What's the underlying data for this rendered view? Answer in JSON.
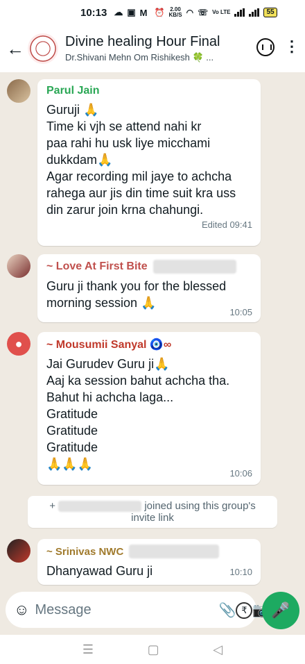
{
  "status_bar": {
    "time": "10:13",
    "net_speed": "2.00",
    "net_unit": "KB/S",
    "network": "Vo LTE",
    "battery": "55"
  },
  "header": {
    "title": "Divine healing Hour Final",
    "subtitle": "Dr.Shivani Mehn Om Rishikesh 🍀 ..."
  },
  "messages": [
    {
      "sender": "Parul Jain",
      "sender_color": "#2aa755",
      "lines": [
        "Guruji 🙏",
        "Time ki vjh se attend nahi kr",
        "paa rahi hu usk liye micchami",
        "dukkdam🙏",
        "Agar recording mil jaye to achcha",
        "rahega aur jis din time suit kra uss",
        "din zarur join krna chahungi."
      ],
      "time": "Edited 09:41"
    },
    {
      "sender": "~ Love At First Bite",
      "sender_color": "#c0504d",
      "lines": [
        "Guru ji thank you for the blessed",
        "morning session 🙏"
      ],
      "time": "10:05"
    },
    {
      "sender": "~ Mousumii Sanyal 🧿∞",
      "sender_color": "#c0392b",
      "lines": [
        "Jai Gurudev Guru ji🙏",
        "Aaj ka session bahut achcha tha.",
        "Bahut hi achcha laga...",
        "Gratitude",
        "Gratitude",
        "Gratitude",
        "🙏🙏🙏"
      ],
      "time": "10:06"
    },
    {
      "sender": "~ Srinivas NWC",
      "sender_color": "#a07a2c",
      "lines": [
        "Dhanyawad Guru ji"
      ],
      "time": "10:10"
    }
  ],
  "system_message": {
    "prefix": "+",
    "text_line1": "joined using this group's",
    "text_line2": "invite link"
  },
  "composer": {
    "placeholder": "Message"
  },
  "colors": {
    "accent": "#1daa61",
    "chat_bg": "#efeae2"
  }
}
